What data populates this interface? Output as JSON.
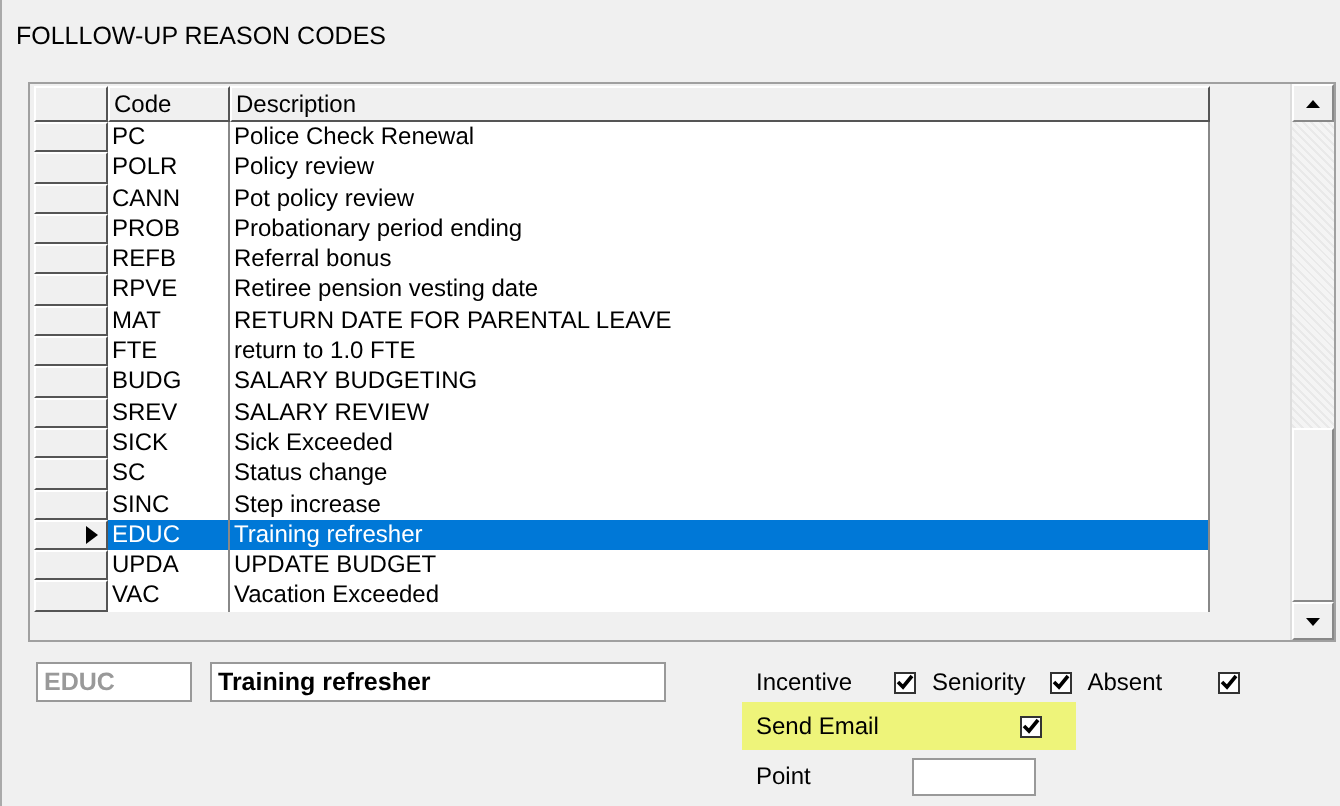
{
  "window": {
    "title": "FOLLLOW-UP REASON CODES"
  },
  "table": {
    "columns": [
      "Code",
      "Description"
    ],
    "rows": [
      {
        "code": "PC",
        "description": "Police Check Renewal",
        "selected": false
      },
      {
        "code": "POLR",
        "description": "Policy review",
        "selected": false
      },
      {
        "code": "CANN",
        "description": "Pot policy review",
        "selected": false
      },
      {
        "code": "PROB",
        "description": "Probationary period ending",
        "selected": false
      },
      {
        "code": "REFB",
        "description": "Referral bonus",
        "selected": false
      },
      {
        "code": "RPVE",
        "description": "Retiree pension vesting date",
        "selected": false
      },
      {
        "code": "MAT",
        "description": "RETURN DATE FOR PARENTAL LEAVE",
        "selected": false
      },
      {
        "code": "FTE",
        "description": "return to 1.0 FTE",
        "selected": false
      },
      {
        "code": "BUDG",
        "description": "SALARY BUDGETING",
        "selected": false
      },
      {
        "code": "SREV",
        "description": "SALARY REVIEW",
        "selected": false
      },
      {
        "code": "SICK",
        "description": "Sick Exceeded",
        "selected": false
      },
      {
        "code": "SC",
        "description": "Status change",
        "selected": false
      },
      {
        "code": "SINC",
        "description": "Step increase",
        "selected": false
      },
      {
        "code": "EDUC",
        "description": "Training refresher",
        "selected": true
      },
      {
        "code": "UPDA",
        "description": "UPDATE BUDGET",
        "selected": false
      },
      {
        "code": "VAC",
        "description": "Vacation Exceeded",
        "selected": false
      }
    ]
  },
  "form": {
    "code_value": "EDUC",
    "description_value": "Training refresher",
    "flags": [
      {
        "label": "Incentive",
        "checked": true
      },
      {
        "label": "Seniority",
        "checked": true
      },
      {
        "label": "Absent",
        "checked": true
      }
    ],
    "send_email": {
      "label": "Send Email",
      "checked": true
    },
    "point": {
      "label": "Point"
    }
  }
}
